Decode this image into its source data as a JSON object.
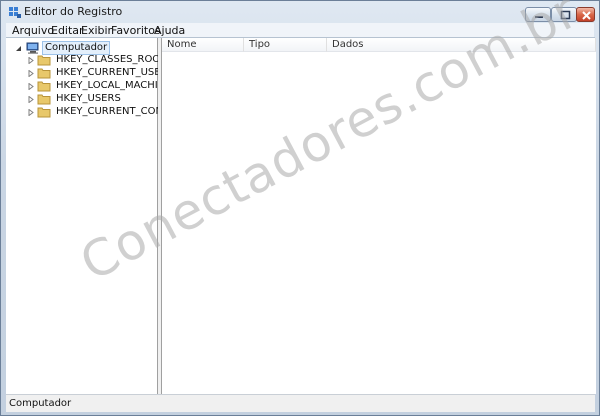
{
  "window": {
    "title": "Editor do Registro"
  },
  "menubar": {
    "items": [
      "Arquivo",
      "Editar",
      "Exibir",
      "Favoritos",
      "Ajuda"
    ]
  },
  "tree": {
    "root": "Computador",
    "children": [
      "HKEY_CLASSES_ROOT",
      "HKEY_CURRENT_USER",
      "HKEY_LOCAL_MACHINE",
      "HKEY_USERS",
      "HKEY_CURRENT_CONFIG"
    ]
  },
  "list": {
    "columns": [
      "Nome",
      "Tipo",
      "Dados"
    ]
  },
  "statusbar": {
    "text": "Computador"
  },
  "watermark": {
    "text": "Conectadores.com.br"
  },
  "colors": {
    "folder": "#e8c86a",
    "selection": "#e3effb",
    "frame": "#c9d3de"
  },
  "icons": [
    "regedit-icon",
    "computer-icon",
    "folder-icon",
    "minimize-icon",
    "maximize-icon",
    "close-icon"
  ]
}
